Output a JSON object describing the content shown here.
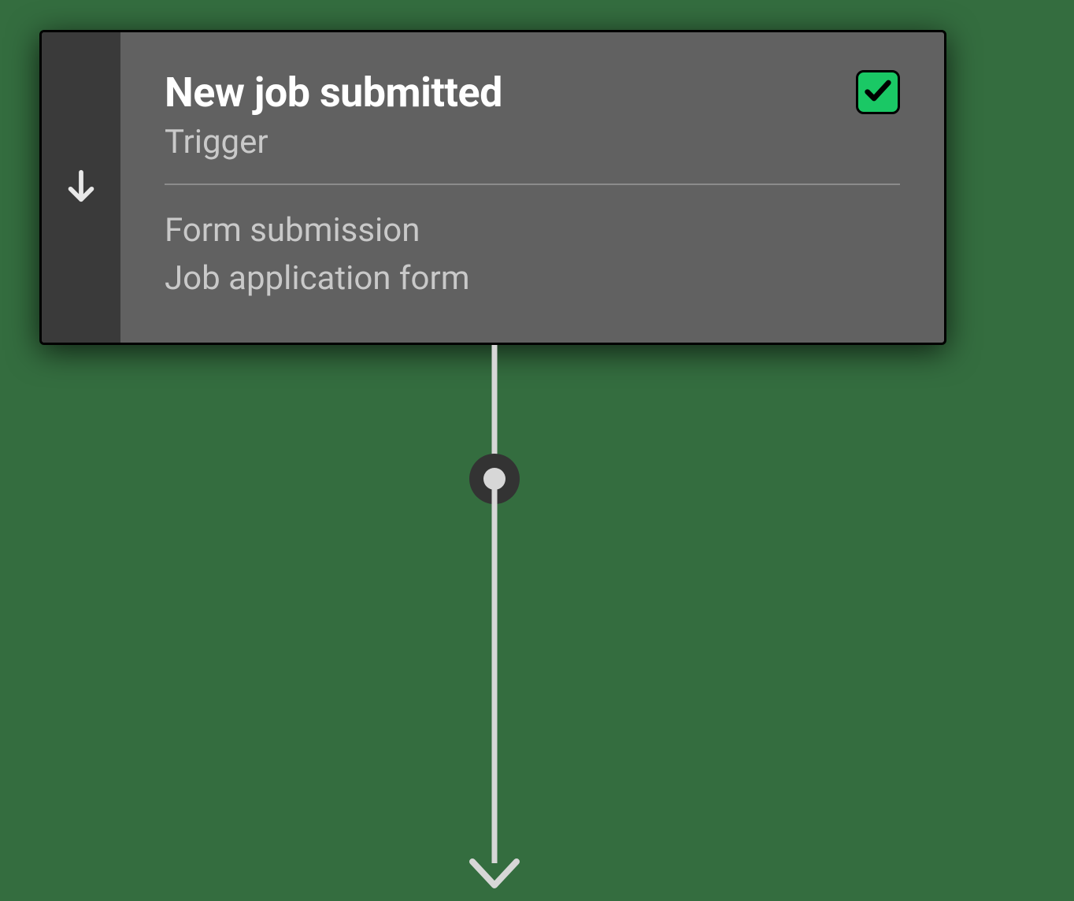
{
  "card": {
    "title": "New job submitted",
    "subtitle": "Trigger",
    "detail_line_1": "Form submission",
    "detail_line_2": "Job application form",
    "status": "success"
  },
  "colors": {
    "success": "#1ac865"
  }
}
